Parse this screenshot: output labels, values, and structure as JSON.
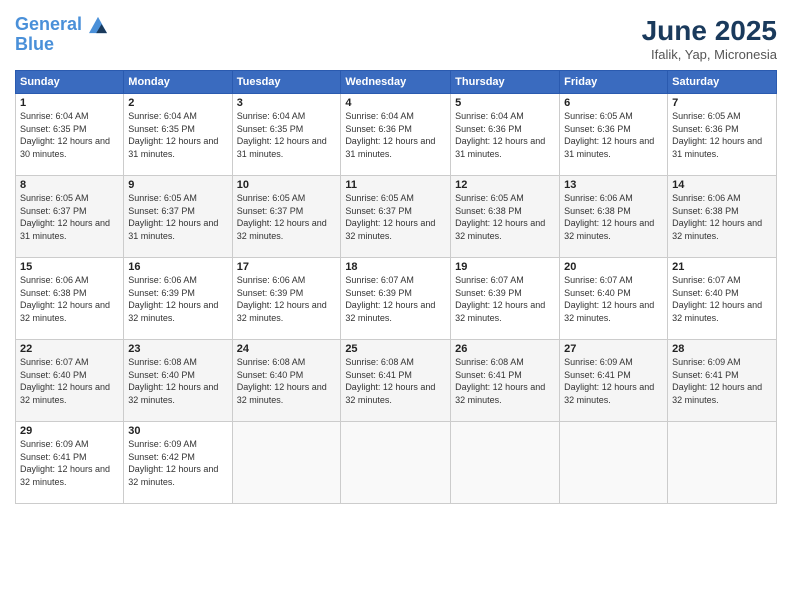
{
  "header": {
    "logo_line1": "General",
    "logo_line2": "Blue",
    "month_title": "June 2025",
    "location": "Ifalik, Yap, Micronesia"
  },
  "days_of_week": [
    "Sunday",
    "Monday",
    "Tuesday",
    "Wednesday",
    "Thursday",
    "Friday",
    "Saturday"
  ],
  "weeks": [
    [
      {
        "day": "1",
        "sunrise": "6:04 AM",
        "sunset": "6:35 PM",
        "daylight": "12 hours and 30 minutes."
      },
      {
        "day": "2",
        "sunrise": "6:04 AM",
        "sunset": "6:35 PM",
        "daylight": "12 hours and 31 minutes."
      },
      {
        "day": "3",
        "sunrise": "6:04 AM",
        "sunset": "6:35 PM",
        "daylight": "12 hours and 31 minutes."
      },
      {
        "day": "4",
        "sunrise": "6:04 AM",
        "sunset": "6:36 PM",
        "daylight": "12 hours and 31 minutes."
      },
      {
        "day": "5",
        "sunrise": "6:04 AM",
        "sunset": "6:36 PM",
        "daylight": "12 hours and 31 minutes."
      },
      {
        "day": "6",
        "sunrise": "6:05 AM",
        "sunset": "6:36 PM",
        "daylight": "12 hours and 31 minutes."
      },
      {
        "day": "7",
        "sunrise": "6:05 AM",
        "sunset": "6:36 PM",
        "daylight": "12 hours and 31 minutes."
      }
    ],
    [
      {
        "day": "8",
        "sunrise": "6:05 AM",
        "sunset": "6:37 PM",
        "daylight": "12 hours and 31 minutes."
      },
      {
        "day": "9",
        "sunrise": "6:05 AM",
        "sunset": "6:37 PM",
        "daylight": "12 hours and 31 minutes."
      },
      {
        "day": "10",
        "sunrise": "6:05 AM",
        "sunset": "6:37 PM",
        "daylight": "12 hours and 32 minutes."
      },
      {
        "day": "11",
        "sunrise": "6:05 AM",
        "sunset": "6:37 PM",
        "daylight": "12 hours and 32 minutes."
      },
      {
        "day": "12",
        "sunrise": "6:05 AM",
        "sunset": "6:38 PM",
        "daylight": "12 hours and 32 minutes."
      },
      {
        "day": "13",
        "sunrise": "6:06 AM",
        "sunset": "6:38 PM",
        "daylight": "12 hours and 32 minutes."
      },
      {
        "day": "14",
        "sunrise": "6:06 AM",
        "sunset": "6:38 PM",
        "daylight": "12 hours and 32 minutes."
      }
    ],
    [
      {
        "day": "15",
        "sunrise": "6:06 AM",
        "sunset": "6:38 PM",
        "daylight": "12 hours and 32 minutes."
      },
      {
        "day": "16",
        "sunrise": "6:06 AM",
        "sunset": "6:39 PM",
        "daylight": "12 hours and 32 minutes."
      },
      {
        "day": "17",
        "sunrise": "6:06 AM",
        "sunset": "6:39 PM",
        "daylight": "12 hours and 32 minutes."
      },
      {
        "day": "18",
        "sunrise": "6:07 AM",
        "sunset": "6:39 PM",
        "daylight": "12 hours and 32 minutes."
      },
      {
        "day": "19",
        "sunrise": "6:07 AM",
        "sunset": "6:39 PM",
        "daylight": "12 hours and 32 minutes."
      },
      {
        "day": "20",
        "sunrise": "6:07 AM",
        "sunset": "6:40 PM",
        "daylight": "12 hours and 32 minutes."
      },
      {
        "day": "21",
        "sunrise": "6:07 AM",
        "sunset": "6:40 PM",
        "daylight": "12 hours and 32 minutes."
      }
    ],
    [
      {
        "day": "22",
        "sunrise": "6:07 AM",
        "sunset": "6:40 PM",
        "daylight": "12 hours and 32 minutes."
      },
      {
        "day": "23",
        "sunrise": "6:08 AM",
        "sunset": "6:40 PM",
        "daylight": "12 hours and 32 minutes."
      },
      {
        "day": "24",
        "sunrise": "6:08 AM",
        "sunset": "6:40 PM",
        "daylight": "12 hours and 32 minutes."
      },
      {
        "day": "25",
        "sunrise": "6:08 AM",
        "sunset": "6:41 PM",
        "daylight": "12 hours and 32 minutes."
      },
      {
        "day": "26",
        "sunrise": "6:08 AM",
        "sunset": "6:41 PM",
        "daylight": "12 hours and 32 minutes."
      },
      {
        "day": "27",
        "sunrise": "6:09 AM",
        "sunset": "6:41 PM",
        "daylight": "12 hours and 32 minutes."
      },
      {
        "day": "28",
        "sunrise": "6:09 AM",
        "sunset": "6:41 PM",
        "daylight": "12 hours and 32 minutes."
      }
    ],
    [
      {
        "day": "29",
        "sunrise": "6:09 AM",
        "sunset": "6:41 PM",
        "daylight": "12 hours and 32 minutes."
      },
      {
        "day": "30",
        "sunrise": "6:09 AM",
        "sunset": "6:42 PM",
        "daylight": "12 hours and 32 minutes."
      },
      null,
      null,
      null,
      null,
      null
    ]
  ],
  "labels": {
    "sunrise_prefix": "Sunrise: ",
    "sunset_prefix": "Sunset: ",
    "daylight_prefix": "Daylight: "
  }
}
